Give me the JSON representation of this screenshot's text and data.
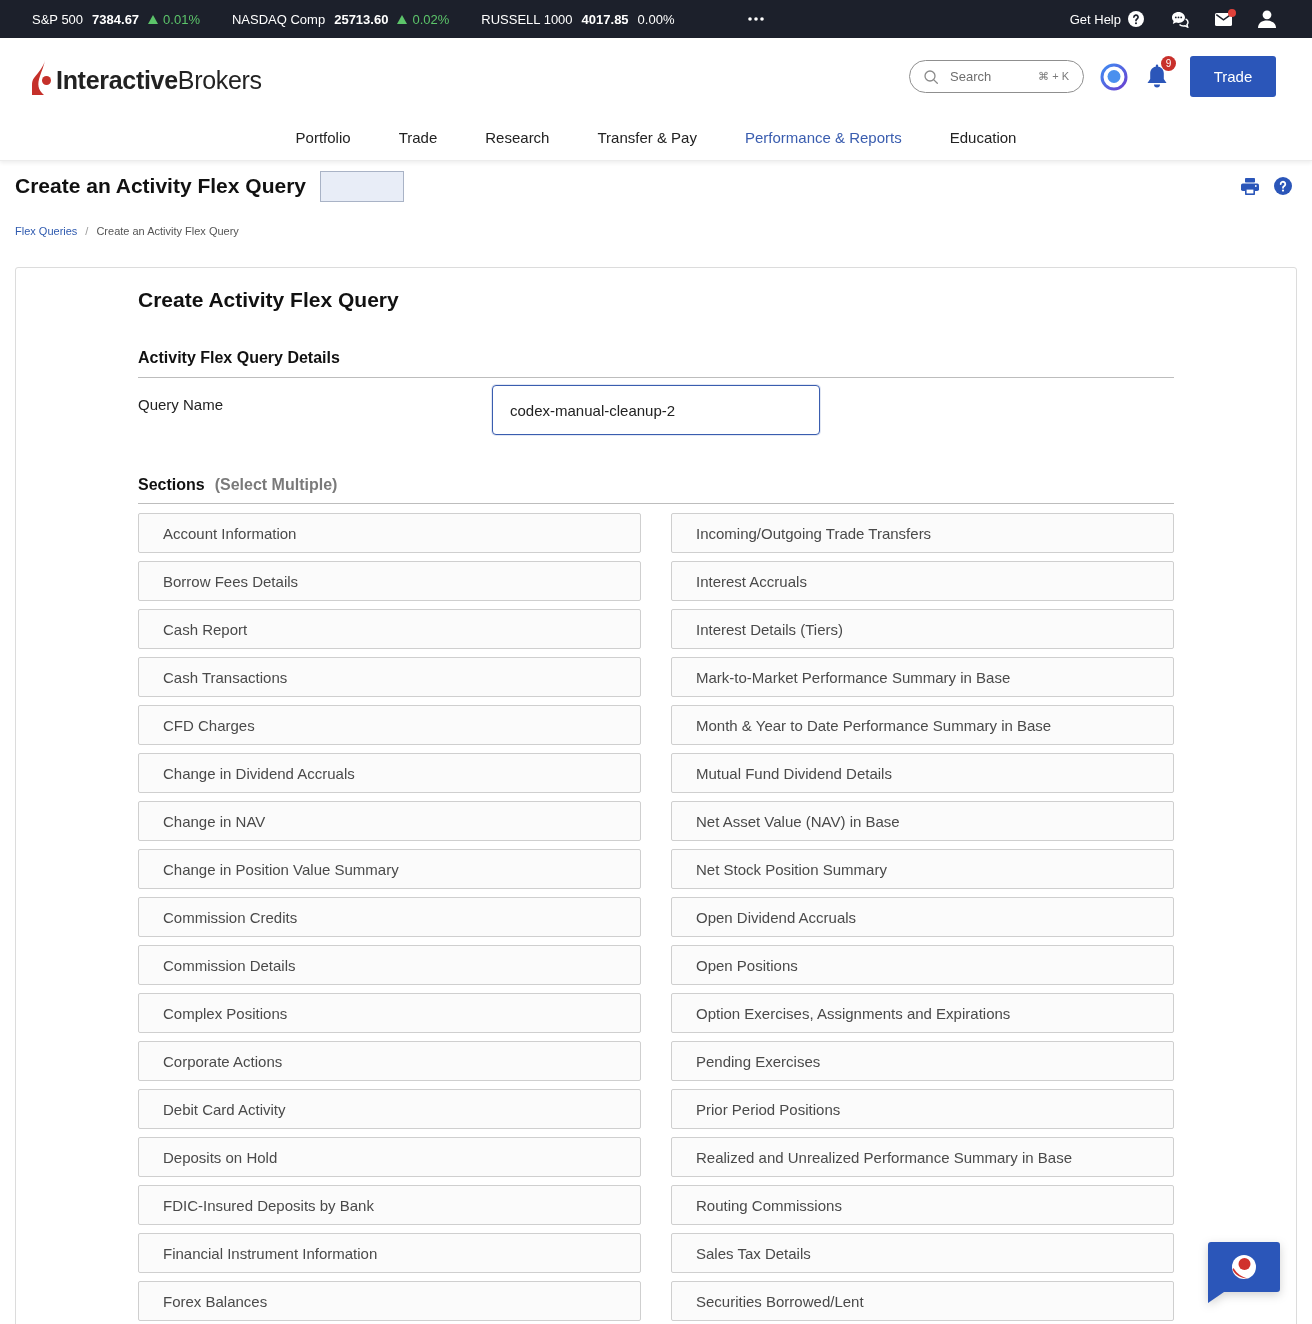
{
  "ticker_bar": {
    "indices": [
      {
        "name": "S&P 500",
        "value": "7384.67",
        "change": "0.01%",
        "kind": "up"
      },
      {
        "name": "NASDAQ Comp",
        "value": "25713.60",
        "change": "0.02%",
        "kind": "up"
      },
      {
        "name": "RUSSELL 1000",
        "value": "4017.85",
        "change": "0.00%",
        "kind": "flat"
      }
    ],
    "help_label": "Get Help",
    "mail": {
      "unread": true
    }
  },
  "header": {
    "logo": "**Interactive**Brokers",
    "search": {
      "placeholder": "Search",
      "shortcut": "⌘ + K"
    },
    "notifications": {
      "count": "9"
    },
    "trade_button": "Trade"
  },
  "nav": [
    {
      "label": "Portfolio",
      "selected": false
    },
    {
      "label": "Trade",
      "selected": false
    },
    {
      "label": "Research",
      "selected": false
    },
    {
      "label": "Transfer & Pay",
      "selected": false
    },
    {
      "label": "Performance & Reports",
      "selected": true
    },
    {
      "label": "Education",
      "selected": false
    }
  ],
  "page": {
    "title": "Create an Activity Flex Query",
    "breadcrumb": {
      "separator": "/",
      "items": [
        {
          "label": "Flex Queries",
          "kind": "link"
        },
        {
          "label": "Create an Activity Flex Query",
          "kind": "current"
        }
      ]
    }
  },
  "form": {
    "title": "Create Activity Flex Query",
    "details_heading": "Activity Flex Query Details",
    "query_name": {
      "label": "Query Name",
      "value": "codex-manual-cleanup-2",
      "focused": true
    },
    "sections": {
      "heading": "Sections",
      "hint": "(Select Multiple)",
      "columns": [
        {
          "items": [
            {
              "label": "Account Information",
              "selected": false
            },
            {
              "label": "Borrow Fees Details",
              "selected": false
            },
            {
              "label": "Cash Report",
              "selected": false
            },
            {
              "label": "Cash Transactions",
              "selected": false
            },
            {
              "label": "CFD Charges",
              "selected": false
            },
            {
              "label": "Change in Dividend Accruals",
              "selected": false
            },
            {
              "label": "Change in NAV",
              "selected": false
            },
            {
              "label": "Change in Position Value Summary",
              "selected": false
            },
            {
              "label": "Commission Credits",
              "selected": false
            },
            {
              "label": "Commission Details",
              "selected": false
            },
            {
              "label": "Complex Positions",
              "selected": false
            },
            {
              "label": "Corporate Actions",
              "selected": false
            },
            {
              "label": "Debit Card Activity",
              "selected": false
            },
            {
              "label": "Deposits on Hold",
              "selected": false
            },
            {
              "label": "FDIC-Insured Deposits by Bank",
              "selected": false
            },
            {
              "label": "Financial Instrument Information",
              "selected": false
            },
            {
              "label": "Forex Balances",
              "selected": false
            }
          ]
        },
        {
          "items": [
            {
              "label": "Incoming/Outgoing Trade Transfers",
              "selected": false
            },
            {
              "label": "Interest Accruals",
              "selected": false
            },
            {
              "label": "Interest Details (Tiers)",
              "selected": false
            },
            {
              "label": "Mark-to-Market Performance Summary in Base",
              "selected": false
            },
            {
              "label": "Month & Year to Date Performance Summary in Base",
              "selected": false
            },
            {
              "label": "Mutual Fund Dividend Details",
              "selected": false
            },
            {
              "label": "Net Asset Value (NAV) in Base",
              "selected": false
            },
            {
              "label": "Net Stock Position Summary",
              "selected": false
            },
            {
              "label": "Open Dividend Accruals",
              "selected": false
            },
            {
              "label": "Open Positions",
              "selected": false
            },
            {
              "label": "Option Exercises, Assignments and Expirations",
              "selected": false
            },
            {
              "label": "Pending Exercises",
              "selected": false
            },
            {
              "label": "Prior Period Positions",
              "selected": false
            },
            {
              "label": "Realized and Unrealized Performance Summary in Base",
              "selected": false
            },
            {
              "label": "Routing Commissions",
              "selected": false
            },
            {
              "label": "Sales Tax Details",
              "selected": false
            },
            {
              "label": "Securities Borrowed/Lent",
              "selected": false
            }
          ]
        }
      ]
    }
  }
}
